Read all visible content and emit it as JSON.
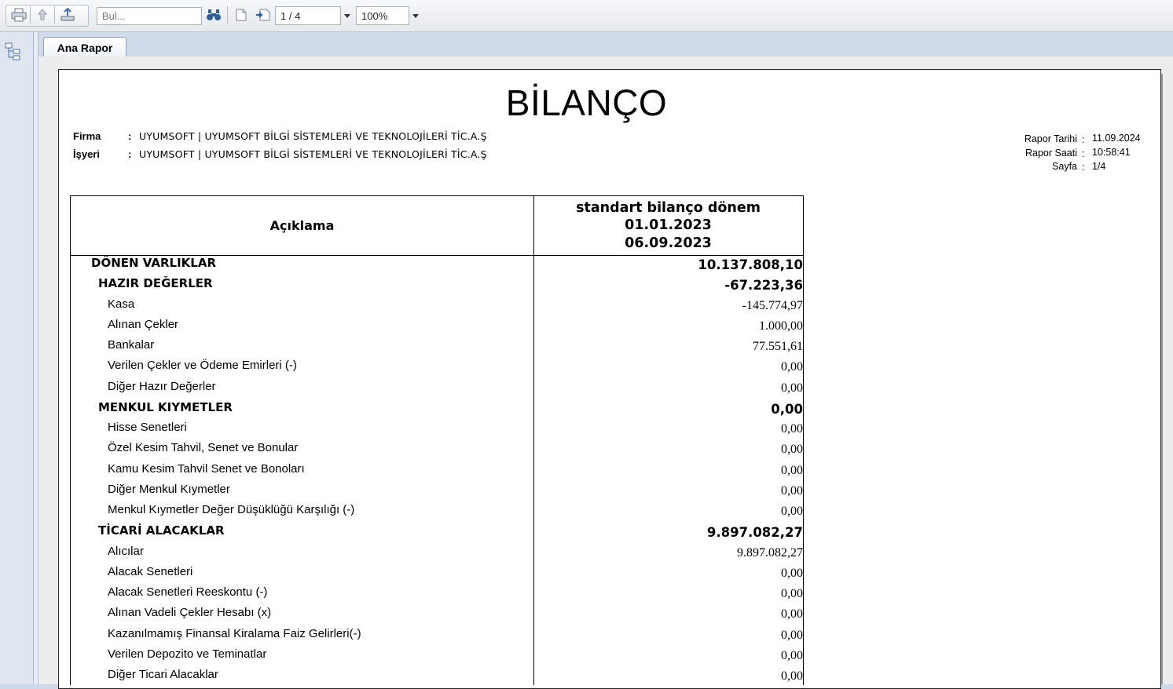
{
  "toolbar": {
    "search_placeholder": "Bul...",
    "page_value": "1 / 4",
    "zoom_value": "100%"
  },
  "tabs": [
    {
      "label": "Ana Rapor"
    }
  ],
  "report": {
    "title": "BİLANÇO",
    "firma_label": "Firma",
    "firma_value": "UYUMSOFT | UYUMSOFT BİLGİ SİSTEMLERİ VE TEKNOLOJİLERİ TİC.A.Ş",
    "isyeri_label": "İşyeri",
    "isyeri_value": "UYUMSOFT | UYUMSOFT BİLGİ SİSTEMLERİ VE TEKNOLOJİLERİ TİC.A.Ş",
    "colon": ":",
    "meta": {
      "rapor_tarihi_label": "Rapor Tarihi",
      "rapor_tarihi_value": "11.09.2024",
      "rapor_saati_label": "Rapor Saati",
      "rapor_saati_value": "10:58:41",
      "sayfa_label": "Sayfa",
      "sayfa_value": "1/4"
    },
    "table": {
      "col_desc": "Açıklama",
      "col_period_line1": "standart bilanço dönem",
      "col_period_line2": "01.01.2023",
      "col_period_line3": "06.09.2023",
      "rows": [
        {
          "level": 1,
          "label": "DÖNEN VARLIKLAR",
          "amount": "10.137.808,10"
        },
        {
          "level": 2,
          "label": "HAZIR DEĞERLER",
          "amount": "-67.223,36"
        },
        {
          "level": 3,
          "label": "Kasa",
          "amount": "-145.774,97"
        },
        {
          "level": 3,
          "label": "Alınan Çekler",
          "amount": "1.000,00"
        },
        {
          "level": 3,
          "label": "Bankalar",
          "amount": "77.551,61"
        },
        {
          "level": 3,
          "label": "Verilen Çekler ve Ödeme Emirleri (-)",
          "amount": "0,00"
        },
        {
          "level": 3,
          "label": "Diğer Hazır Değerler",
          "amount": "0,00"
        },
        {
          "level": 2,
          "label": "MENKUL KIYMETLER",
          "amount": "0,00"
        },
        {
          "level": 3,
          "label": "Hisse Senetleri",
          "amount": "0,00"
        },
        {
          "level": 3,
          "label": "Özel Kesim Tahvil, Senet ve Bonular",
          "amount": "0,00"
        },
        {
          "level": 3,
          "label": "Kamu Kesim Tahvil Senet ve Bonoları",
          "amount": "0,00"
        },
        {
          "level": 3,
          "label": "Diğer Menkul Kıymetler",
          "amount": "0,00"
        },
        {
          "level": 3,
          "label": "Menkul Kıymetler Değer Düşüklüğü Karşılığı (-)",
          "amount": "0,00"
        },
        {
          "level": 2,
          "label": "TİCARİ ALACAKLAR",
          "amount": "9.897.082,27"
        },
        {
          "level": 3,
          "label": "Alıcılar",
          "amount": "9.897.082,27"
        },
        {
          "level": 3,
          "label": "Alacak Senetleri",
          "amount": "0,00"
        },
        {
          "level": 3,
          "label": "Alacak Senetleri Reeskontu (-)",
          "amount": "0,00"
        },
        {
          "level": 3,
          "label": "Alınan Vadeli Çekler Hesabı (x)",
          "amount": "0,00"
        },
        {
          "level": 3,
          "label": "Kazanılmamış Finansal Kiralama Faiz Gelirleri(-)",
          "amount": "0,00"
        },
        {
          "level": 3,
          "label": "Verilen Depozito ve Teminatlar",
          "amount": "0,00"
        },
        {
          "level": 3,
          "label": "Diğer Ticari Alacaklar",
          "amount": "0,00"
        }
      ]
    }
  },
  "icons": {
    "print": "printer-icon",
    "export": "export-icon",
    "send": "send-icon",
    "find": "binoculars-icon",
    "first_page": "page-prev-icon",
    "next_page": "page-next-icon",
    "tree": "document-map-icon"
  }
}
